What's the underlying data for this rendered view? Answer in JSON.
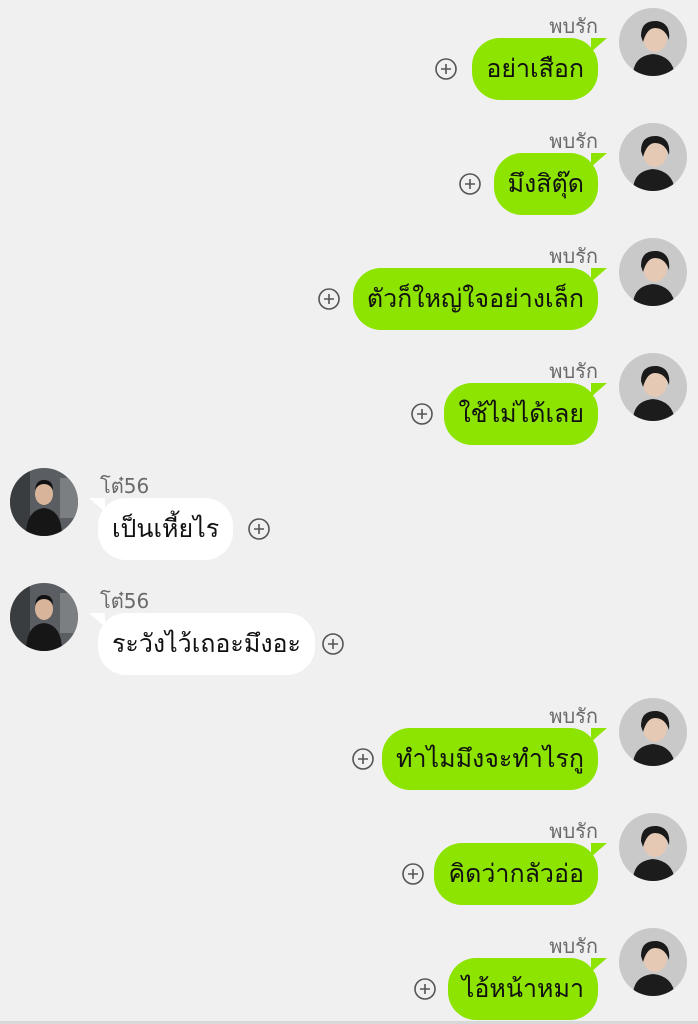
{
  "colors": {
    "background": "#f0f0f0",
    "outgoing_bubble": "#8de400",
    "incoming_bubble": "#ffffff",
    "sender_name": "#6a6a6a"
  },
  "icons": {
    "add_reaction": "circle-plus-icon",
    "avatar": "profile-photo"
  },
  "messages": [
    {
      "direction": "outgoing",
      "sender": "พบรัก",
      "text": "อย่าเสือก"
    },
    {
      "direction": "outgoing",
      "sender": "พบรัก",
      "text": "มึงสิตุ๊ด"
    },
    {
      "direction": "outgoing",
      "sender": "พบรัก",
      "text": "ตัวก็ใหญ่ใจอย่างเล็ก"
    },
    {
      "direction": "outgoing",
      "sender": "พบรัก",
      "text": "ใช้ไม่ได้เลย"
    },
    {
      "direction": "incoming",
      "sender": "โต๋56",
      "text": "เป็นเหี้ยไร"
    },
    {
      "direction": "incoming",
      "sender": "โต๋56",
      "text": "ระวังไว้เถอะมึงอะ"
    },
    {
      "direction": "outgoing",
      "sender": "พบรัก",
      "text": "ทำไมมึงจะทำไรกู"
    },
    {
      "direction": "outgoing",
      "sender": "พบรัก",
      "text": "คิดว่ากลัวอ่อ"
    },
    {
      "direction": "outgoing",
      "sender": "พบรัก",
      "text": "ไอ้หน้าหมา"
    }
  ]
}
